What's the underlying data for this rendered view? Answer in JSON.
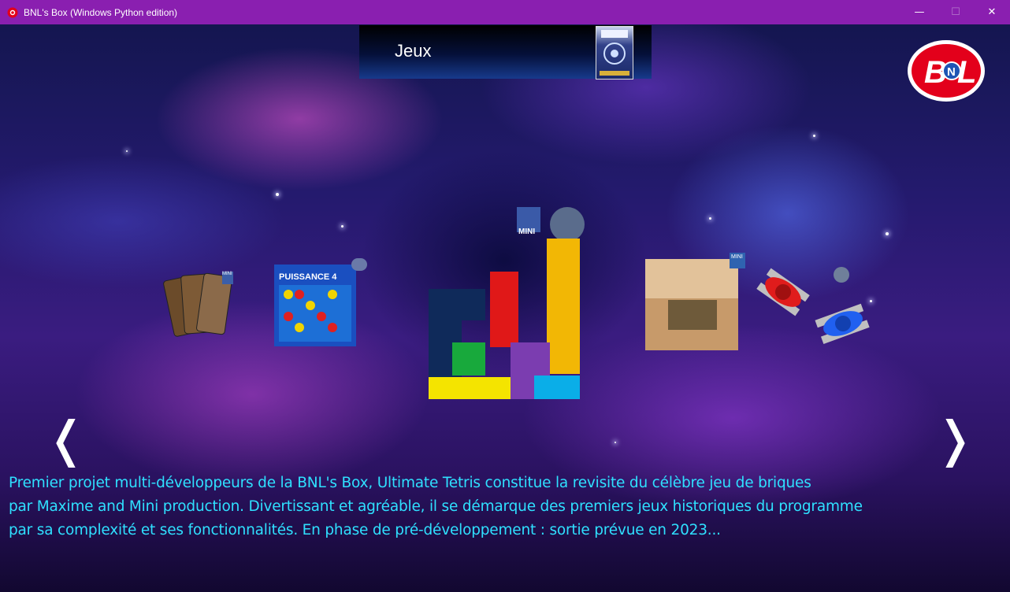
{
  "window": {
    "title": "BNL's Box (Windows Python edition)",
    "controls": {
      "minimize": "—",
      "maximize": "☐",
      "close": "✕"
    }
  },
  "header": {
    "title": "Jeux"
  },
  "logo": {
    "text": "BNL"
  },
  "carousel": {
    "items": [
      {
        "id": "cards-game",
        "badge": "MINI"
      },
      {
        "id": "puissance-4",
        "label": "PUISSANCE 4"
      },
      {
        "id": "ultimate-tetris",
        "badge": "MINI",
        "selected": true
      },
      {
        "id": "wall-e-game",
        "badge": "MINI"
      },
      {
        "id": "tanks-game"
      }
    ]
  },
  "navigation": {
    "prev": "❬",
    "next": "❭"
  },
  "description": {
    "lines": [
      "Premier projet multi-développeurs de la BNL's Box, Ultimate Tetris constitue la revisite du célèbre jeu de briques",
      "par Maxime and Mini production. Divertissant et agréable, il se démarque des premiers jeux historiques du programme",
      "par sa complexité et ses fonctionnalités. En phase de pré-développement : sortie prévue en 2023..."
    ]
  },
  "colors": {
    "titlebar": "#8a1fb0",
    "description_text": "#2fe0ff",
    "logo_red": "#e3001b"
  }
}
